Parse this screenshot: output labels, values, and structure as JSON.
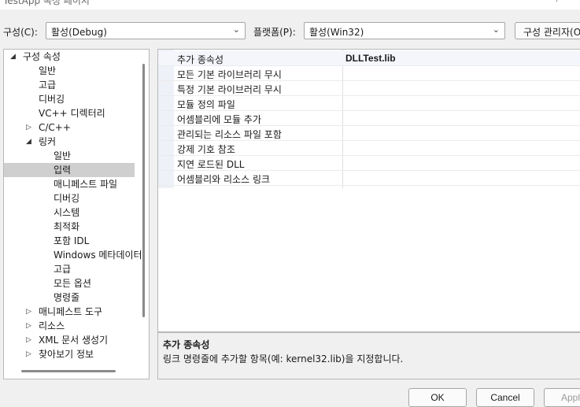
{
  "window": {
    "title": "TestApp 속성 페이지",
    "help_label": "?"
  },
  "config": {
    "config_label": "구성(C):",
    "config_value": "활성(Debug)",
    "platform_label": "플랫폼(P):",
    "platform_value": "활성(Win32)",
    "manager_label": "구성 관리자(O"
  },
  "tree": {
    "items": [
      {
        "label": "구성 속성",
        "level": 0,
        "expand": "open"
      },
      {
        "label": "일반",
        "level": 1,
        "expand": "none"
      },
      {
        "label": "고급",
        "level": 1,
        "expand": "none"
      },
      {
        "label": "디버깅",
        "level": 1,
        "expand": "none"
      },
      {
        "label": "VC++ 디렉터리",
        "level": 1,
        "expand": "none"
      },
      {
        "label": "C/C++",
        "level": 1,
        "expand": "closed"
      },
      {
        "label": "링커",
        "level": 1,
        "expand": "open"
      },
      {
        "label": "일반",
        "level": 2,
        "expand": "none"
      },
      {
        "label": "입력",
        "level": 2,
        "expand": "none",
        "selected": true
      },
      {
        "label": "매니페스트 파일",
        "level": 2,
        "expand": "none"
      },
      {
        "label": "디버깅",
        "level": 2,
        "expand": "none"
      },
      {
        "label": "시스템",
        "level": 2,
        "expand": "none"
      },
      {
        "label": "최적화",
        "level": 2,
        "expand": "none"
      },
      {
        "label": "포함 IDL",
        "level": 2,
        "expand": "none"
      },
      {
        "label": "Windows 메타데이터",
        "level": 2,
        "expand": "none"
      },
      {
        "label": "고급",
        "level": 2,
        "expand": "none"
      },
      {
        "label": "모든 옵션",
        "level": 2,
        "expand": "none"
      },
      {
        "label": "명령줄",
        "level": 2,
        "expand": "none"
      },
      {
        "label": "매니페스트 도구",
        "level": 1,
        "expand": "closed"
      },
      {
        "label": "리소스",
        "level": 1,
        "expand": "closed"
      },
      {
        "label": "XML 문서 생성기",
        "level": 1,
        "expand": "closed"
      },
      {
        "label": "찾아보기 정보",
        "level": 1,
        "expand": "closed"
      }
    ]
  },
  "properties": [
    {
      "name": "추가 종속성",
      "value": "DLLTest.lib"
    },
    {
      "name": "모든 기본 라이브러리 무시",
      "value": ""
    },
    {
      "name": "특정 기본 라이브러리 무시",
      "value": ""
    },
    {
      "name": "모듈 정의 파일",
      "value": ""
    },
    {
      "name": "어셈블리에 모듈 추가",
      "value": ""
    },
    {
      "name": "관리되는 리소스 파일 포함",
      "value": ""
    },
    {
      "name": "강제 기호 참조",
      "value": ""
    },
    {
      "name": "지연 로드된 DLL",
      "value": ""
    },
    {
      "name": "어셈블리와 리소스 링크",
      "value": ""
    }
  ],
  "description": {
    "title": "추가 종속성",
    "text": "링크 명령줄에 추가할 항목(예: kernel32.lib)을 지정합니다."
  },
  "buttons": {
    "ok": "OK",
    "cancel": "Cancel",
    "apply": "Apply"
  },
  "icons": {
    "expand_open": "triangle-down-icon",
    "expand_closed": "triangle-right-icon",
    "dropdown": "chevron-down-icon"
  }
}
